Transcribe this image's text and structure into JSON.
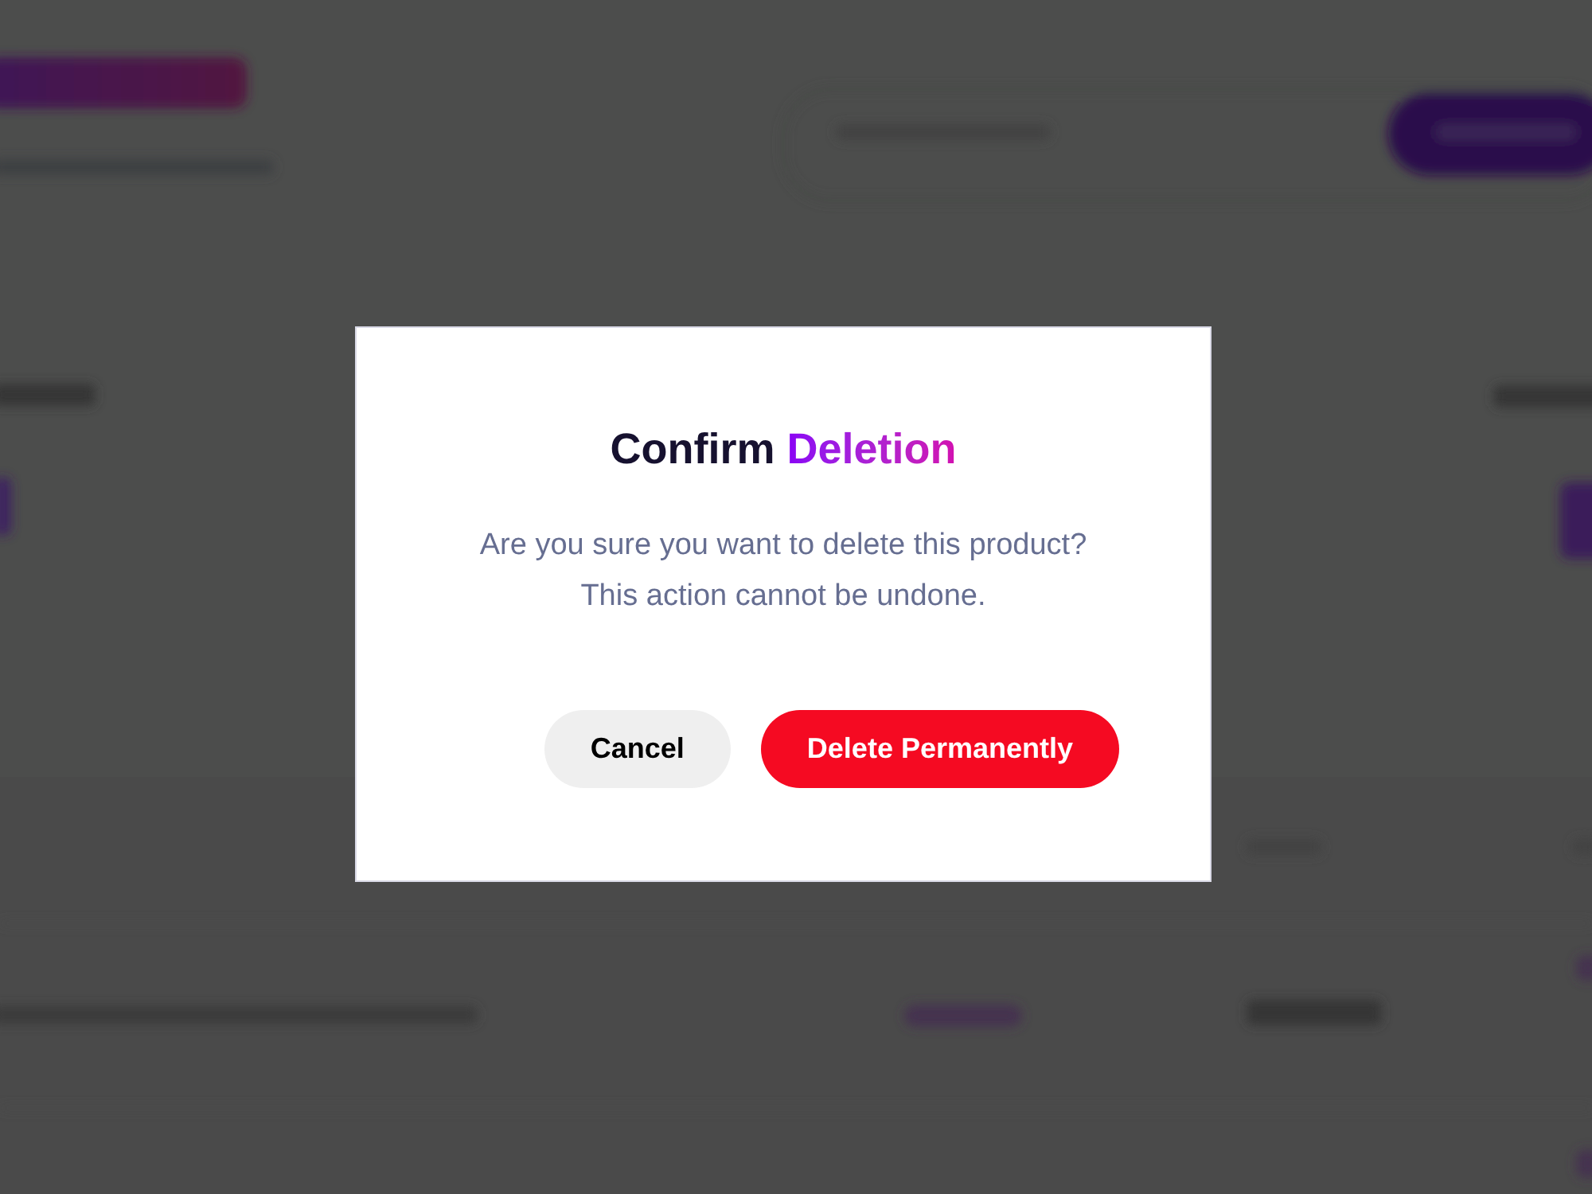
{
  "dialog": {
    "title": {
      "text": "Confirm",
      "highlight": "Deletion"
    },
    "message": "Are you sure you want to delete this product? This action cannot be undone.",
    "buttons": [
      {
        "label": "Cancel",
        "kind": "secondary"
      },
      {
        "label": "Delete Permanently",
        "kind": "danger"
      }
    ]
  }
}
